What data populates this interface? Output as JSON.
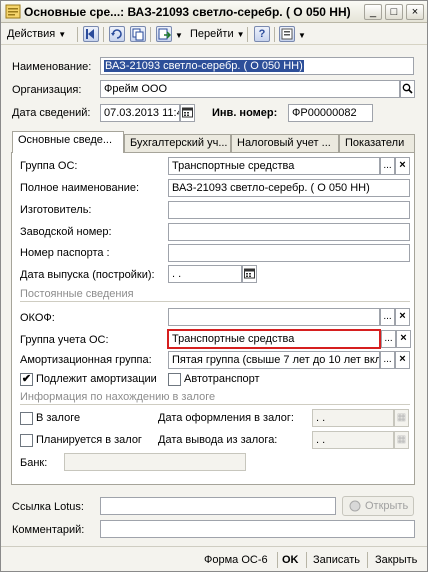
{
  "window": {
    "title": "Основные сре...: ВАЗ-21093 светло-серебр. ( О 050 НН)",
    "buttons": {
      "minimize": "_",
      "maximize": "□",
      "close": "×"
    }
  },
  "toolbar": {
    "actions_label": "Действия",
    "goto_label": "Перейти",
    "help_label": "?"
  },
  "header": {
    "name_label": "Наименование:",
    "name_value": "ВАЗ-21093 светло-серебр. ( О 050 НН)",
    "org_label": "Организация:",
    "org_value": "Фрейм ООО",
    "date_label": "Дата сведений:",
    "date_value": "07.03.2013 11:4",
    "inv_label": "Инв. номер:",
    "inv_value": "ФР00000082"
  },
  "tabs": [
    {
      "label": "Основные сведе..."
    },
    {
      "label": "Бухгалтерский уч..."
    },
    {
      "label": "Налоговый учет ..."
    },
    {
      "label": "Показатели"
    }
  ],
  "main": {
    "group_os_label": "Группа ОС:",
    "group_os_value": "Транспортные средства",
    "full_name_label": "Полное наименование:",
    "full_name_value": "ВАЗ-21093 светло-серебр. ( О 050 НН)",
    "manufacturer_label": "Изготовитель:",
    "manufacturer_value": "",
    "serial_label": "Заводской номер:",
    "serial_value": "",
    "passport_label": "Номер паспорта :",
    "passport_value": "",
    "release_date_label": "Дата выпуска (постройки):",
    "release_date_value": " .  .",
    "permanent_section": "Постоянные сведения",
    "okof_label": "ОКОФ:",
    "okof_value": "",
    "account_group_label": "Группа учета ОС:",
    "account_group_value": "Транспортные средства",
    "amort_group_label": "Амортизационная группа:",
    "amort_group_value": "Пятая группа (свыше 7 лет до 10 лет вкл",
    "amort_check_label": "Подлежит амортизации",
    "amort_checked": true,
    "auto_check_label": "Автотранспорт",
    "auto_checked": false,
    "pledge_section": "Информация по нахождению в залоге",
    "pledge_label": "В залоге",
    "pledge_planned_label": "Планируется в залог",
    "pledge_date_label": "Дата оформления в залог:",
    "pledge_date_value": " .  .",
    "pledge_out_label": "Дата вывода из залога:",
    "pledge_out_value": " .  .",
    "bank_label": "Банк:",
    "bank_value": ""
  },
  "footer": {
    "lotus_label": "Ссылка Lotus:",
    "lotus_value": "",
    "open_label": "Открыть",
    "comment_label": "Комментарий:",
    "comment_value": "",
    "form_label": "Форма ОС-6",
    "ok_label": "OK",
    "save_label": "Записать",
    "close_label": "Закрыть"
  },
  "colors": {
    "highlight_border": "#d61f1f",
    "selection": "#2d4f99"
  }
}
